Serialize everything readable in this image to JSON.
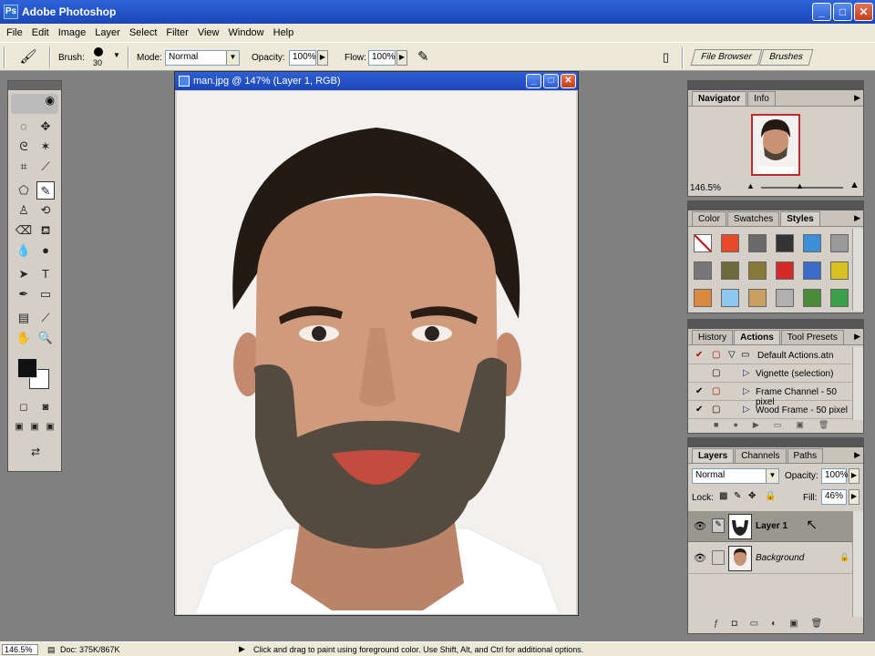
{
  "titlebar": {
    "title": "Adobe Photoshop",
    "minimize": "_",
    "maximize": "□",
    "close": "✕"
  },
  "menu": [
    "File",
    "Edit",
    "Image",
    "Layer",
    "Select",
    "Filter",
    "View",
    "Window",
    "Help"
  ],
  "options": {
    "brush_label": "Brush:",
    "brush_size": "30",
    "mode_label": "Mode:",
    "mode_value": "Normal",
    "opacity_label": "Opacity:",
    "opacity_value": "100%",
    "flow_label": "Flow:",
    "flow_value": "100%",
    "file_browser": "File Browser",
    "brushes": "Brushes"
  },
  "document": {
    "title": "man.jpg @ 147% (Layer 1, RGB)"
  },
  "navigator": {
    "tabs": [
      "Navigator",
      "Info"
    ],
    "zoom": "146.5%"
  },
  "styles_panel": {
    "tabs": [
      "Color",
      "Swatches",
      "Styles"
    ],
    "swatch_colors": [
      "#ffffff",
      "#e8492b",
      "#6a6a6a",
      "#333333",
      "#3d8fd8",
      "#9a9a9a",
      "#777777",
      "#6b6b3c",
      "#8a7a3a",
      "#d42a2a",
      "#3a6cc8",
      "#d8c020",
      "#d88a40",
      "#8ac8f0",
      "#c8a060",
      "#b0b0b0",
      "#4a8a3a",
      "#3aa04a"
    ]
  },
  "actions_panel": {
    "tabs": [
      "History",
      "Actions",
      "Tool Presets"
    ],
    "items": [
      "Default Actions.atn",
      "Vignette (selection)",
      "Frame Channel - 50 pixel",
      "Wood Frame - 50 pixel"
    ]
  },
  "layers_panel": {
    "tabs": [
      "Layers",
      "Channels",
      "Paths"
    ],
    "blend_mode": "Normal",
    "opacity_label": "Opacity:",
    "opacity_value": "100%",
    "lock_label": "Lock:",
    "fill_label": "Fill:",
    "fill_value": "46%",
    "layers": [
      {
        "name": "Layer 1"
      },
      {
        "name": "Background"
      }
    ]
  },
  "status": {
    "zoom": "146.5%",
    "doc": "Doc: 375K/867K",
    "hint": "Click and drag to paint using foreground color.  Use Shift, Alt, and Ctrl for additional options."
  }
}
